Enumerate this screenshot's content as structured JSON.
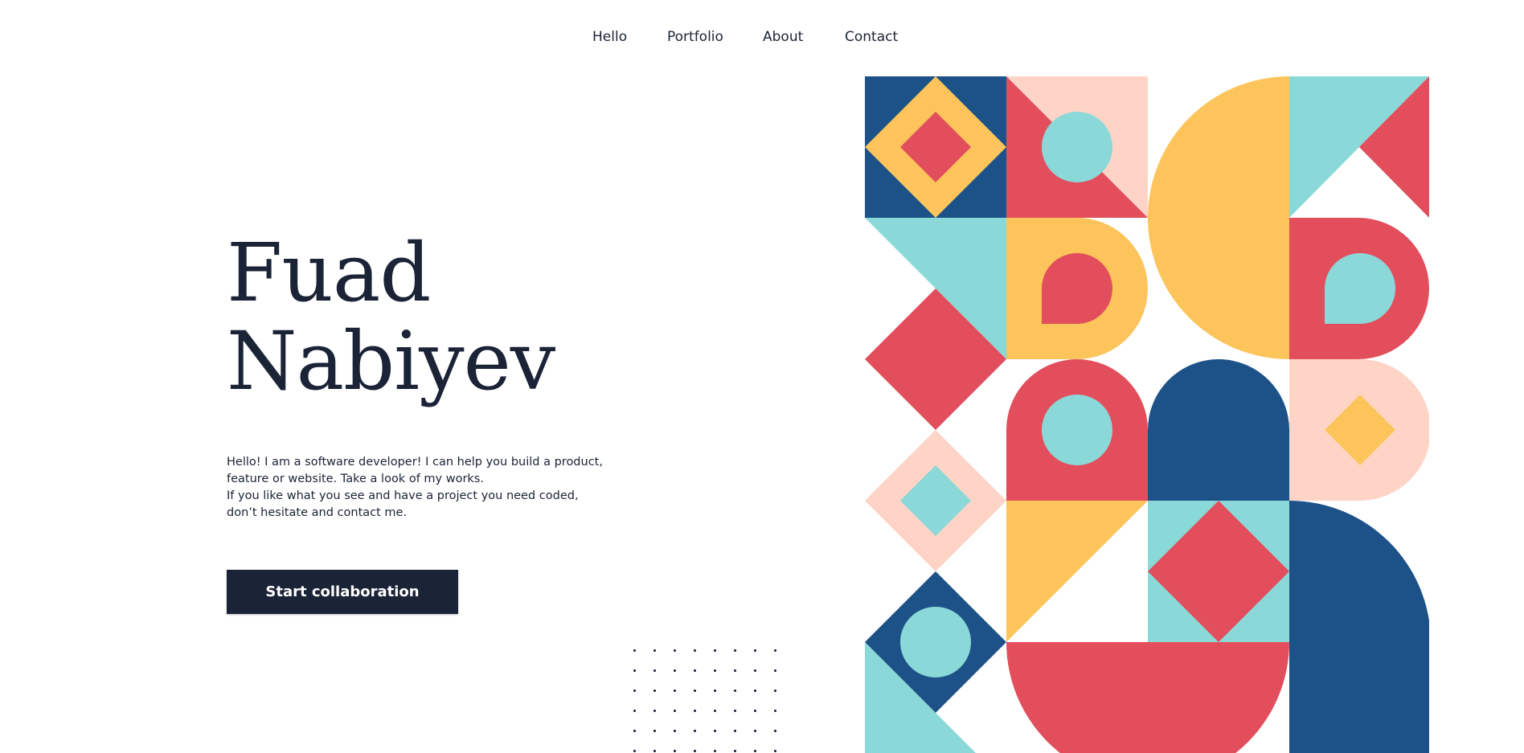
{
  "nav": {
    "items": [
      "Hello",
      "Portfolio",
      "About",
      "Contact"
    ]
  },
  "hero": {
    "first_name": "Fuad",
    "last_name": "Nabiyev",
    "intro_line1": "Hello! I am a software developer! I can help you build a product, feature or website. Take a look of my works.",
    "intro_line2": "If you like what you see and have a project you need coded, don’t hesitate and contact me.",
    "cta_label": "Start collaboration"
  },
  "colors": {
    "navy": "#1d5289",
    "gold": "#fcc45a",
    "coral": "#e24e5c",
    "teal": "#8bd8d9",
    "peach": "#fed4c6",
    "ink": "#1b2336"
  }
}
